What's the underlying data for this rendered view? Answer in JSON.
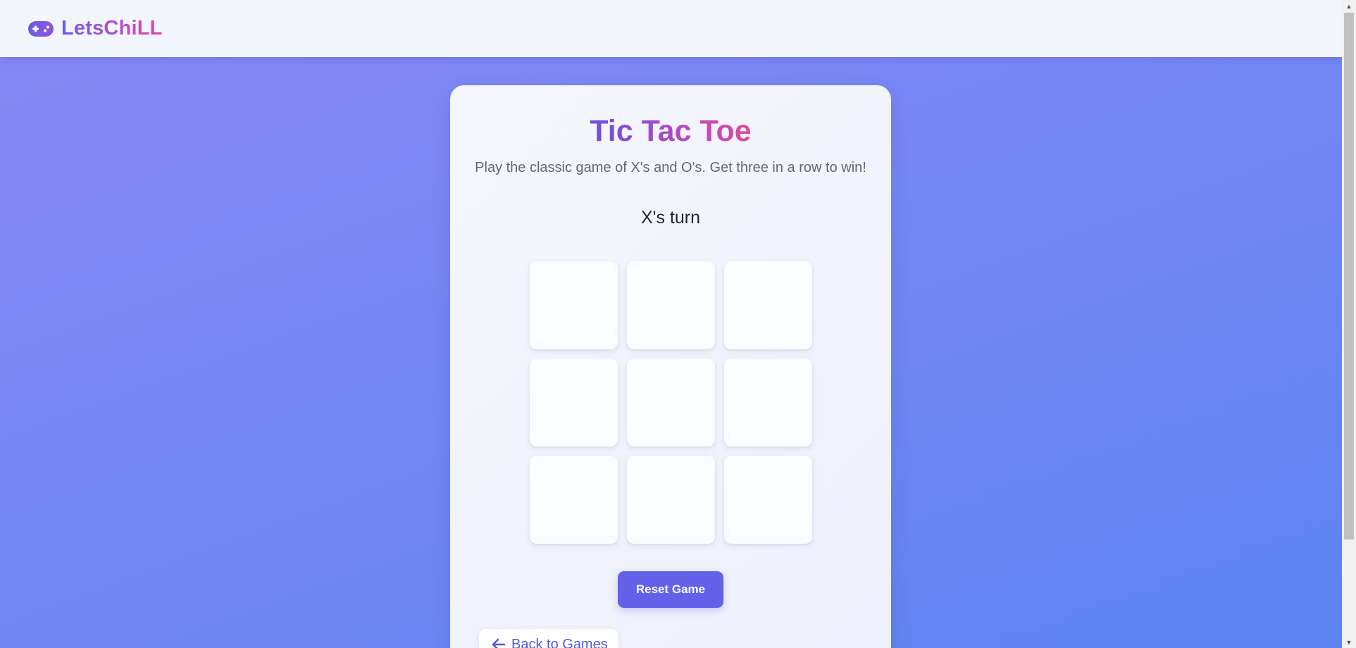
{
  "navbar": {
    "brand_icon": "gamepad-icon",
    "brand_name": "LetsChiLL"
  },
  "game": {
    "title": "Tic Tac Toe",
    "description": "Play the classic game of X's and O's. Get three in a row to win!",
    "status": "X's turn",
    "board": [
      "",
      "",
      "",
      "",
      "",
      "",
      "",
      "",
      ""
    ],
    "reset_label": "Reset Game",
    "back_label": "Back to Games",
    "back_icon": "arrow-left-icon"
  },
  "colors": {
    "accent": "#6360ea",
    "title_gradient_start": "#6b4fdc",
    "title_gradient_end": "#df4a9c"
  }
}
